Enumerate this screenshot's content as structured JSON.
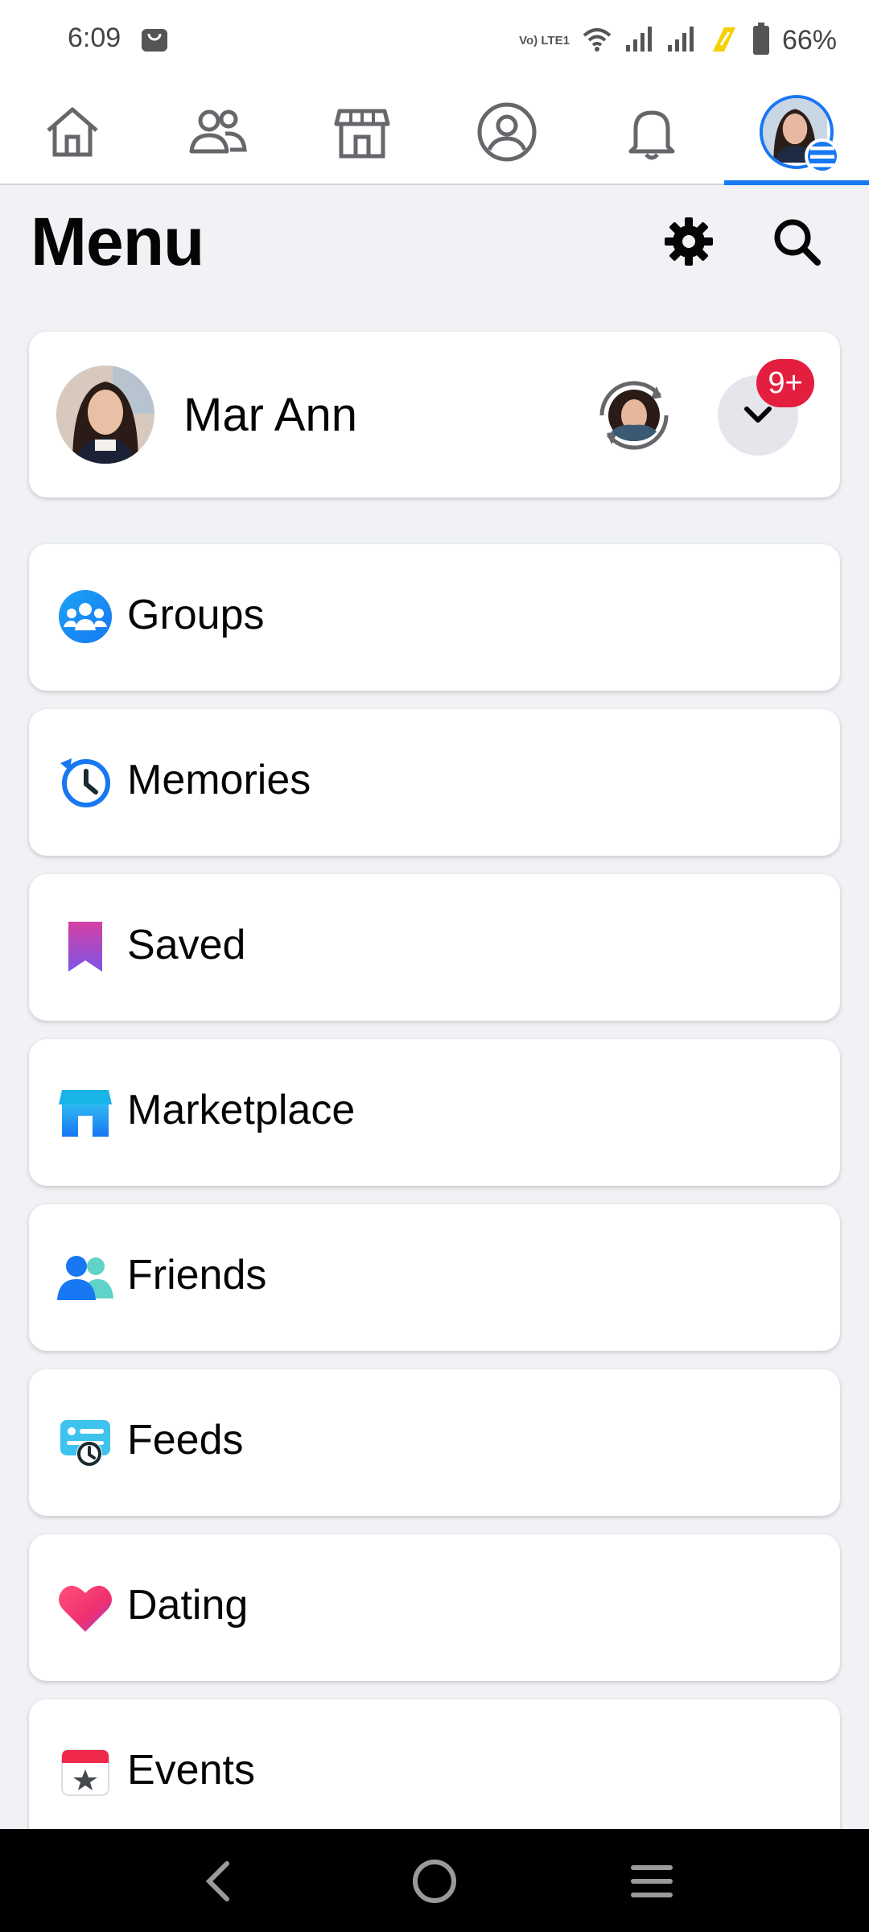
{
  "status_bar": {
    "time": "6:09",
    "battery_percent": "66%",
    "network_label": "Vo) LTE1",
    "icons": [
      "shopping-bag-icon",
      "wifi-icon",
      "signal-icon",
      "signal-icon",
      "charging-icon",
      "battery-icon"
    ]
  },
  "top_nav": {
    "tabs": [
      {
        "name": "home",
        "icon": "home-icon",
        "active": false
      },
      {
        "name": "friends",
        "icon": "friends-icon",
        "active": false
      },
      {
        "name": "marketplace",
        "icon": "marketplace-icon",
        "active": false
      },
      {
        "name": "profile",
        "icon": "profile-icon",
        "active": false
      },
      {
        "name": "notifications",
        "icon": "bell-icon",
        "active": false
      },
      {
        "name": "menu",
        "icon": "avatar-menu-icon",
        "active": true
      }
    ],
    "active_color": "#1877f2"
  },
  "header": {
    "title": "Menu"
  },
  "profile": {
    "name": "Mar Ann",
    "badge": "9+"
  },
  "menu_items": [
    {
      "label": "Groups",
      "icon": "groups-icon"
    },
    {
      "label": "Memories",
      "icon": "memories-icon"
    },
    {
      "label": "Saved",
      "icon": "saved-icon"
    },
    {
      "label": "Marketplace",
      "icon": "marketplace-icon"
    },
    {
      "label": "Friends",
      "icon": "friends-icon"
    },
    {
      "label": "Feeds",
      "icon": "feeds-icon"
    },
    {
      "label": "Dating",
      "icon": "dating-icon"
    },
    {
      "label": "Events",
      "icon": "events-icon"
    }
  ],
  "colors": {
    "brand": "#1877f2",
    "badge": "#e41e3f",
    "background": "#f0f2f5"
  }
}
